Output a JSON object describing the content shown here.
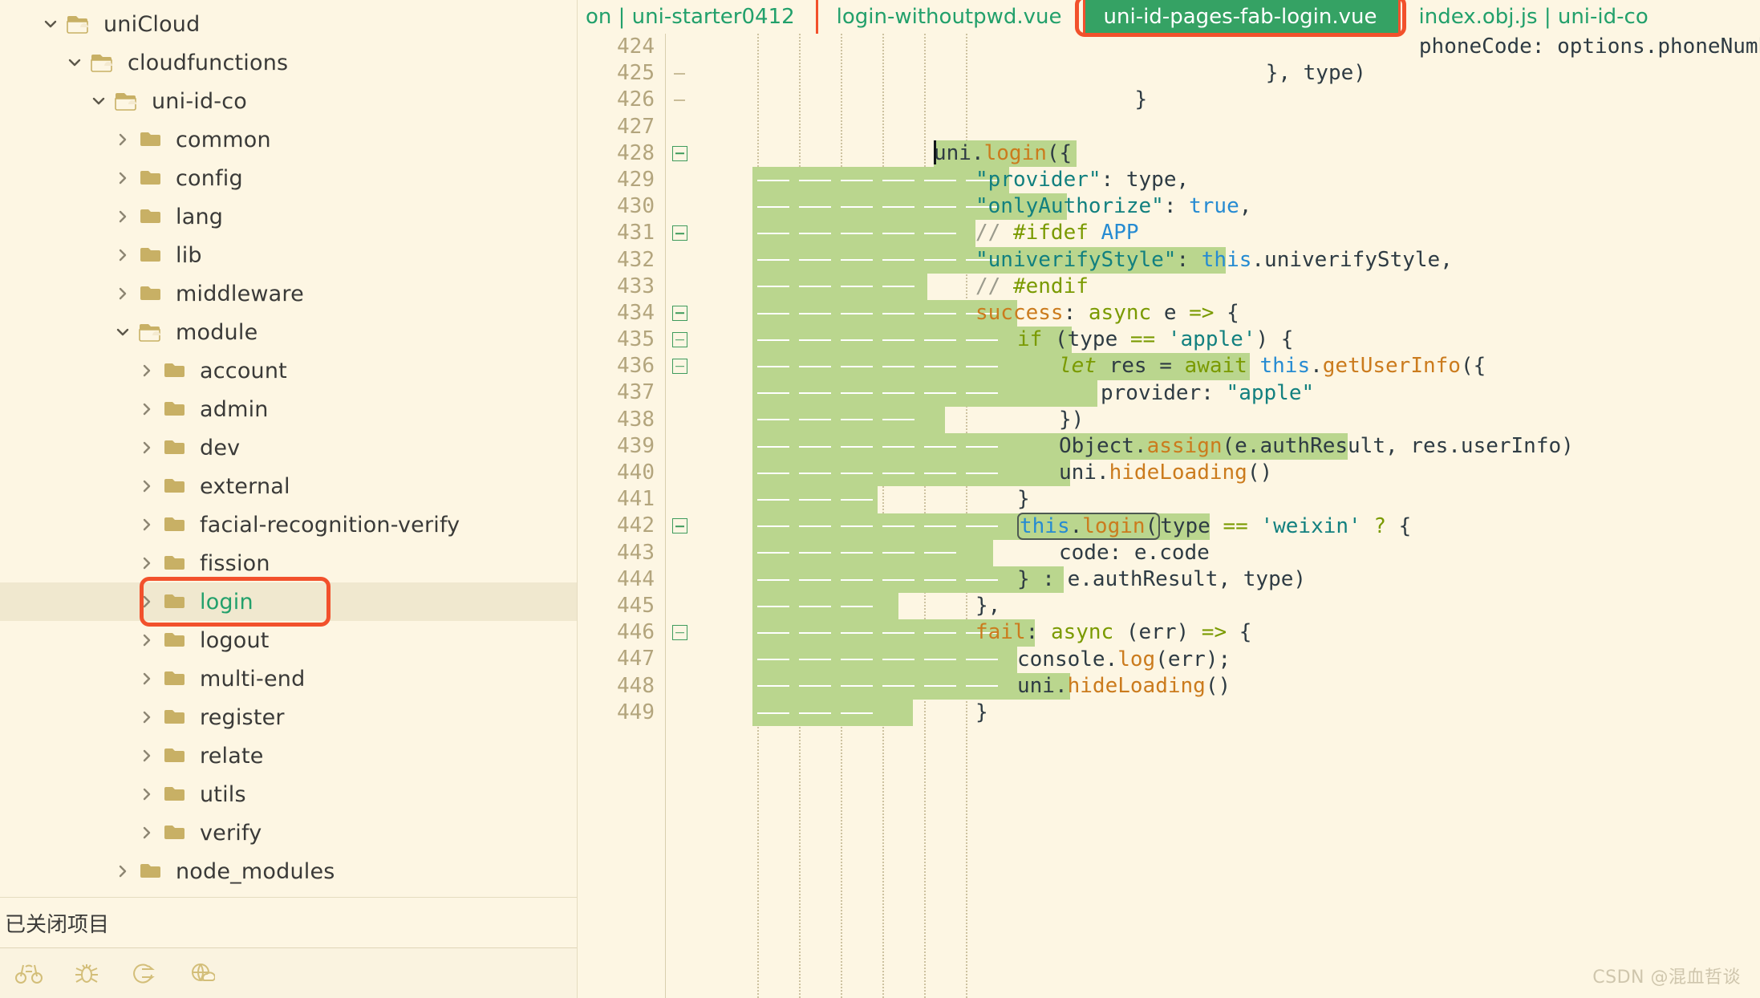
{
  "sidebar": {
    "tree": [
      {
        "label": "uniCloud",
        "depth": 0,
        "twisty": "chevron-down-icon",
        "icon": "folder-open-icon",
        "state": "expanded"
      },
      {
        "label": "cloudfunctions",
        "depth": 1,
        "twisty": "chevron-down-icon",
        "icon": "folder-open-icon",
        "state": "expanded"
      },
      {
        "label": "uni-id-co",
        "depth": 2,
        "twisty": "chevron-down-icon",
        "icon": "folder-open-icon",
        "state": "expanded"
      },
      {
        "label": "common",
        "depth": 3,
        "twisty": "chevron-right-icon",
        "icon": "folder-icon",
        "state": "collapsed"
      },
      {
        "label": "config",
        "depth": 3,
        "twisty": "chevron-right-icon",
        "icon": "folder-icon",
        "state": "collapsed"
      },
      {
        "label": "lang",
        "depth": 3,
        "twisty": "chevron-right-icon",
        "icon": "folder-icon",
        "state": "collapsed"
      },
      {
        "label": "lib",
        "depth": 3,
        "twisty": "chevron-right-icon",
        "icon": "folder-icon",
        "state": "collapsed"
      },
      {
        "label": "middleware",
        "depth": 3,
        "twisty": "chevron-right-icon",
        "icon": "folder-icon",
        "state": "collapsed"
      },
      {
        "label": "module",
        "depth": 3,
        "twisty": "chevron-down-icon",
        "icon": "folder-open-icon",
        "state": "expanded"
      },
      {
        "label": "account",
        "depth": 4,
        "twisty": "chevron-right-icon",
        "icon": "folder-icon",
        "state": "collapsed"
      },
      {
        "label": "admin",
        "depth": 4,
        "twisty": "chevron-right-icon",
        "icon": "folder-icon",
        "state": "collapsed"
      },
      {
        "label": "dev",
        "depth": 4,
        "twisty": "chevron-right-icon",
        "icon": "folder-icon",
        "state": "collapsed"
      },
      {
        "label": "external",
        "depth": 4,
        "twisty": "chevron-right-icon",
        "icon": "folder-icon",
        "state": "collapsed"
      },
      {
        "label": "facial-recognition-verify",
        "depth": 4,
        "twisty": "chevron-right-icon",
        "icon": "folder-icon",
        "state": "collapsed"
      },
      {
        "label": "fission",
        "depth": 4,
        "twisty": "chevron-right-icon",
        "icon": "folder-icon",
        "state": "collapsed"
      },
      {
        "label": "login",
        "depth": 4,
        "twisty": "chevron-right-icon",
        "icon": "folder-icon",
        "state": "collapsed",
        "selected": true,
        "highlighted": true
      },
      {
        "label": "logout",
        "depth": 4,
        "twisty": "chevron-right-icon",
        "icon": "folder-icon",
        "state": "collapsed"
      },
      {
        "label": "multi-end",
        "depth": 4,
        "twisty": "chevron-right-icon",
        "icon": "folder-icon",
        "state": "collapsed"
      },
      {
        "label": "register",
        "depth": 4,
        "twisty": "chevron-right-icon",
        "icon": "folder-icon",
        "state": "collapsed"
      },
      {
        "label": "relate",
        "depth": 4,
        "twisty": "chevron-right-icon",
        "icon": "folder-icon",
        "state": "collapsed"
      },
      {
        "label": "utils",
        "depth": 4,
        "twisty": "chevron-right-icon",
        "icon": "folder-icon",
        "state": "collapsed"
      },
      {
        "label": "verify",
        "depth": 4,
        "twisty": "chevron-right-icon",
        "icon": "folder-icon",
        "state": "collapsed"
      },
      {
        "label": "node_modules",
        "depth": 3,
        "twisty": "chevron-right-icon",
        "icon": "folder-icon",
        "state": "collapsed"
      }
    ],
    "closed_projects_label": "已关闭项目",
    "bottom_tools": [
      {
        "name": "binoculars-icon"
      },
      {
        "name": "bug-icon"
      },
      {
        "name": "export-arrow-icon"
      },
      {
        "name": "globe-cloud-icon"
      }
    ]
  },
  "tabs": [
    {
      "label": "on | uni-starter0412",
      "active": false,
      "partial": true
    },
    {
      "label": "login-withoutpwd.vue",
      "active": false
    },
    {
      "label": "uni-id-pages-fab-login.vue",
      "active": true,
      "annotated": true
    },
    {
      "label": "index.obj.js | uni-id-co",
      "active": false
    }
  ],
  "editor": {
    "first_line": 424,
    "lines": [
      {
        "n": 424,
        "fold": "none",
        "tokens": [
          {
            "t": "                \t\t",
            "c": "plain"
          },
          {
            "t": "phoneCode: options.phoneNumberCode",
            "c": "plain"
          }
        ]
      },
      {
        "n": 425,
        "fold": "dash",
        "tokens": [
          {
            "t": "            \t\t",
            "c": "plain"
          },
          {
            "t": "}, type)",
            "c": "plain"
          }
        ]
      },
      {
        "n": 426,
        "fold": "dash",
        "tokens": [
          {
            "t": "        \t",
            "c": "plain"
          },
          {
            "t": "}",
            "c": "plain"
          }
        ]
      },
      {
        "n": 427,
        "fold": "none",
        "tokens": []
      },
      {
        "n": 428,
        "fold": "box",
        "tokens": [
          {
            "t": "uni.",
            "c": "plain"
          },
          {
            "t": "login",
            "c": "fn"
          },
          {
            "t": "({",
            "c": "plain"
          }
        ]
      },
      {
        "n": 429,
        "fold": "none",
        "tokens": [
          {
            "t": "\"provider\"",
            "c": "str"
          },
          {
            "t": ": type,",
            "c": "plain"
          }
        ]
      },
      {
        "n": 430,
        "fold": "none",
        "tokens": [
          {
            "t": "\"onlyAuthorize\"",
            "c": "str"
          },
          {
            "t": ": ",
            "c": "plain"
          },
          {
            "t": "true",
            "c": "blue"
          },
          {
            "t": ",",
            "c": "plain"
          }
        ]
      },
      {
        "n": 431,
        "fold": "box",
        "tokens": [
          {
            "t": "// ",
            "c": "com"
          },
          {
            "t": "#ifdef",
            "c": "kw"
          },
          {
            "t": " ",
            "c": "plain"
          },
          {
            "t": "APP",
            "c": "blue"
          }
        ]
      },
      {
        "n": 432,
        "fold": "none",
        "tokens": [
          {
            "t": "\"univerifyStyle\"",
            "c": "str"
          },
          {
            "t": ": ",
            "c": "plain"
          },
          {
            "t": "this",
            "c": "this"
          },
          {
            "t": ".univerifyStyle,",
            "c": "plain"
          }
        ]
      },
      {
        "n": 433,
        "fold": "none",
        "tokens": [
          {
            "t": "// ",
            "c": "com"
          },
          {
            "t": "#endif",
            "c": "kw"
          }
        ]
      },
      {
        "n": 434,
        "fold": "box",
        "tokens": [
          {
            "t": "success",
            "c": "fn"
          },
          {
            "t": ": ",
            "c": "plain"
          },
          {
            "t": "async",
            "c": "kw"
          },
          {
            "t": " e ",
            "c": "plain"
          },
          {
            "t": "=>",
            "c": "kw"
          },
          {
            "t": " {",
            "c": "plain"
          }
        ]
      },
      {
        "n": 435,
        "fold": "box",
        "tokens": [
          {
            "t": "if",
            "c": "kw"
          },
          {
            "t": " (type ",
            "c": "plain"
          },
          {
            "t": "==",
            "c": "kw"
          },
          {
            "t": " ",
            "c": "plain"
          },
          {
            "t": "'apple'",
            "c": "str"
          },
          {
            "t": ") {",
            "c": "plain"
          }
        ]
      },
      {
        "n": 436,
        "fold": "box",
        "tokens": [
          {
            "t": "let",
            "c": "kwi"
          },
          {
            "t": " res = ",
            "c": "plain"
          },
          {
            "t": "await",
            "c": "kw"
          },
          {
            "t": " ",
            "c": "plain"
          },
          {
            "t": "this",
            "c": "this"
          },
          {
            "t": ".",
            "c": "plain"
          },
          {
            "t": "getUserInfo",
            "c": "fn"
          },
          {
            "t": "({",
            "c": "plain"
          }
        ]
      },
      {
        "n": 437,
        "fold": "none",
        "tokens": [
          {
            "t": "provider: ",
            "c": "plain"
          },
          {
            "t": "\"apple\"",
            "c": "str"
          }
        ]
      },
      {
        "n": 438,
        "fold": "none",
        "tokens": [
          {
            "t": "})",
            "c": "plain"
          }
        ]
      },
      {
        "n": 439,
        "fold": "none",
        "tokens": [
          {
            "t": "Object.",
            "c": "plain"
          },
          {
            "t": "assign",
            "c": "fn"
          },
          {
            "t": "(e.authResult, res.userInfo)",
            "c": "plain"
          }
        ]
      },
      {
        "n": 440,
        "fold": "none",
        "tokens": [
          {
            "t": "uni.",
            "c": "plain"
          },
          {
            "t": "hideLoading",
            "c": "fn"
          },
          {
            "t": "()",
            "c": "plain"
          }
        ]
      },
      {
        "n": 441,
        "fold": "none",
        "tokens": [
          {
            "t": "}",
            "c": "plain"
          }
        ]
      },
      {
        "n": 442,
        "fold": "box",
        "tokens": [
          {
            "t": "this",
            "c": "this"
          },
          {
            "t": ".",
            "c": "plain"
          },
          {
            "t": "login",
            "c": "fn"
          },
          {
            "t": "(",
            "c": "plain"
          },
          {
            "t": "type ",
            "c": "plain"
          },
          {
            "t": "==",
            "c": "kw"
          },
          {
            "t": " ",
            "c": "plain"
          },
          {
            "t": "'weixin'",
            "c": "str"
          },
          {
            "t": " ",
            "c": "plain"
          },
          {
            "t": "?",
            "c": "kw"
          },
          {
            "t": " {",
            "c": "plain"
          }
        ]
      },
      {
        "n": 443,
        "fold": "none",
        "tokens": [
          {
            "t": "code: e.code",
            "c": "plain"
          }
        ]
      },
      {
        "n": 444,
        "fold": "none",
        "tokens": [
          {
            "t": "} : e.authResult, type)",
            "c": "plain"
          }
        ]
      },
      {
        "n": 445,
        "fold": "none",
        "tokens": [
          {
            "t": "},",
            "c": "plain"
          }
        ]
      },
      {
        "n": 446,
        "fold": "box",
        "tokens": [
          {
            "t": "fail",
            "c": "fn"
          },
          {
            "t": ": ",
            "c": "plain"
          },
          {
            "t": "async",
            "c": "kw"
          },
          {
            "t": " (err) ",
            "c": "plain"
          },
          {
            "t": "=>",
            "c": "kw"
          },
          {
            "t": " {",
            "c": "plain"
          }
        ]
      },
      {
        "n": 447,
        "fold": "none",
        "tokens": [
          {
            "t": "console.",
            "c": "plain"
          },
          {
            "t": "log",
            "c": "fn"
          },
          {
            "t": "(err);",
            "c": "plain"
          }
        ]
      },
      {
        "n": 448,
        "fold": "none",
        "tokens": [
          {
            "t": "uni.",
            "c": "plain"
          },
          {
            "t": "hideLoading",
            "c": "fn"
          },
          {
            "t": "()",
            "c": "plain"
          }
        ]
      },
      {
        "n": 449,
        "fold": "none",
        "tokens": [
          {
            "t": "}",
            "c": "plain"
          }
        ]
      }
    ],
    "code_text": [
      "                phoneCode: options.phoneNumberCode",
      "            }, type)",
      "        }",
      "",
      "uni.login({",
      "    \"provider\": type,",
      "    \"onlyAuthorize\": true,",
      "    // #ifdef APP",
      "    \"univerifyStyle\": this.univerifyStyle,",
      "    // #endif",
      "    success: async e => {",
      "        if (type == 'apple') {",
      "            let res = await this.getUserInfo({",
      "                provider: \"apple\"",
      "            })",
      "            Object.assign(e.authResult, res.userInfo)",
      "            uni.hideLoading()",
      "        }",
      "        this.login(type == 'weixin' ? {",
      "            code: e.code",
      "        } : e.authResult, type)",
      "    },",
      "    fail: async (err) => {",
      "        console.log(err);",
      "        uni.hideLoading()",
      "    }",
      "}"
    ]
  },
  "watermark": "CSDN @混血哲谈",
  "colors": {
    "background": "#fdf6e3",
    "selection": "#bad68e",
    "accent_green": "#35a264",
    "annotation_red": "#f2512c",
    "folder_tan": "#c8b065",
    "string_teal": "#12807f",
    "function_orange": "#cb7b1d",
    "keyword_olive": "#7a9a01",
    "this_blue": "#268bd2",
    "comment_gray": "#9b9b8d",
    "row_highlight": "#f0e8cf"
  }
}
